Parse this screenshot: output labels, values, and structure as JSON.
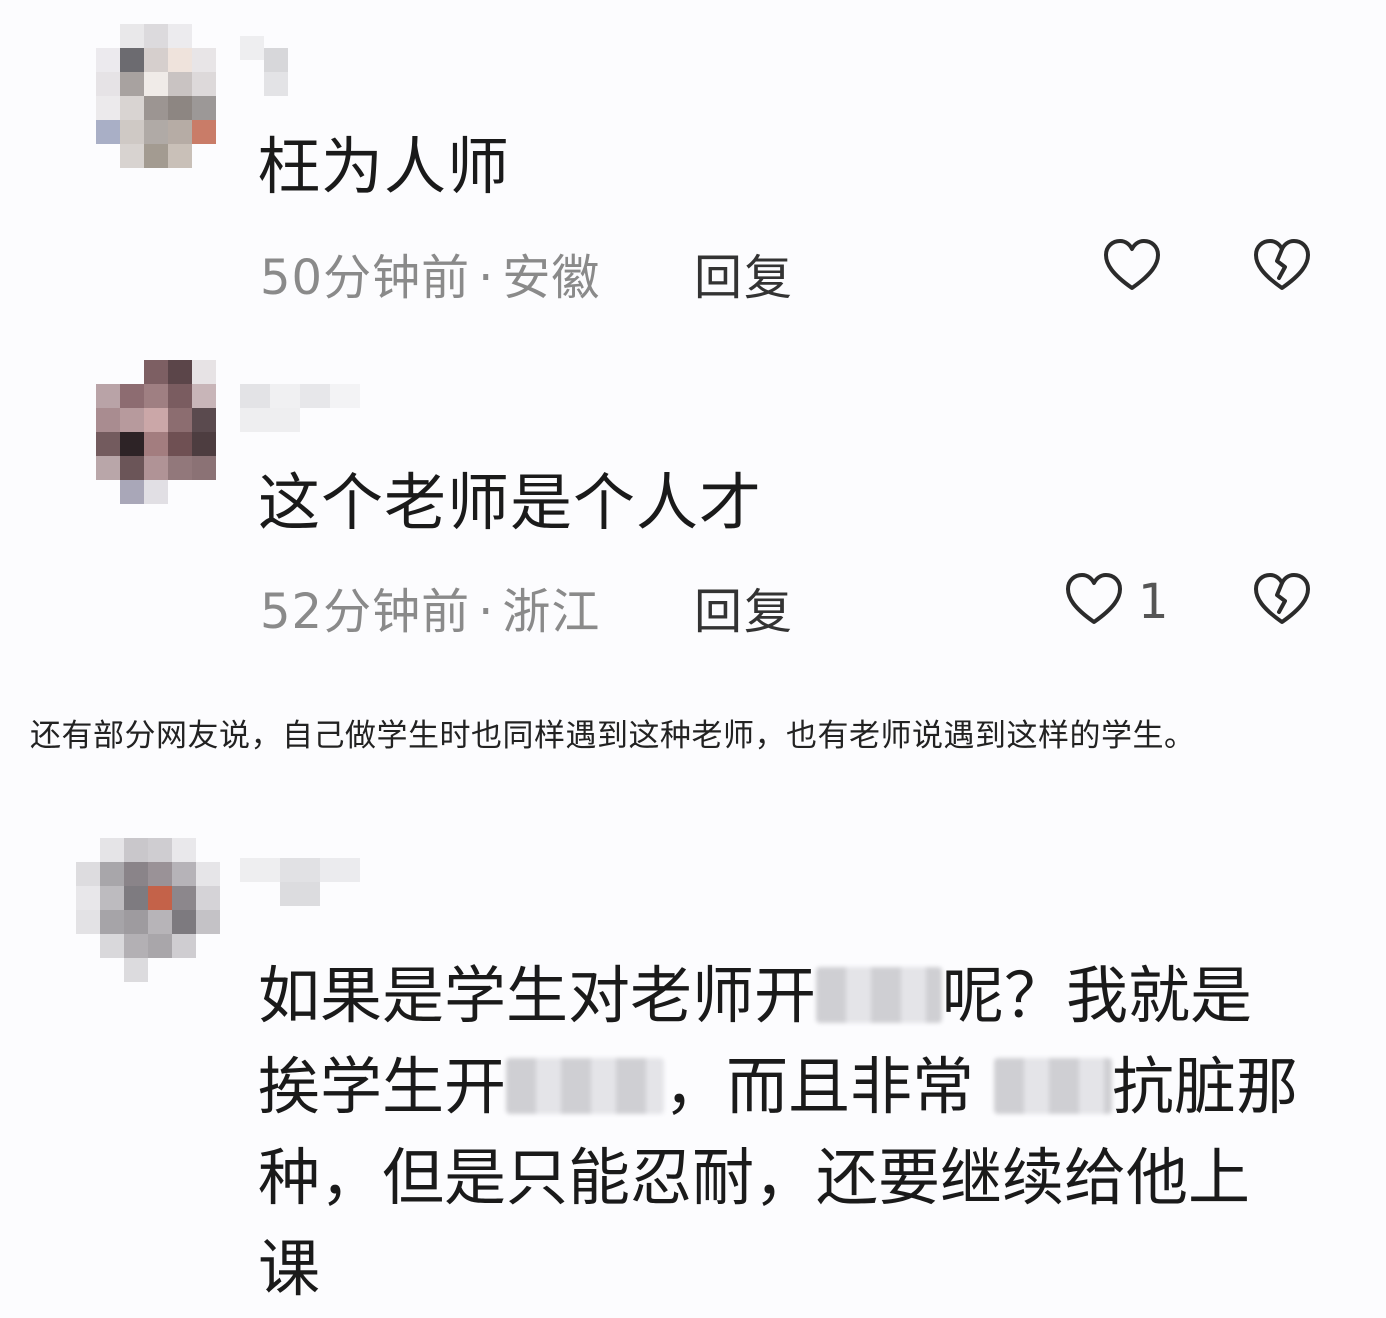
{
  "comments": [
    {
      "text": "枉为人师",
      "time": "50分钟前",
      "location": "安徽",
      "reply_label": "回复",
      "like_count": ""
    },
    {
      "text": "这个老师是个人才",
      "time": "52分钟前",
      "location": "浙江",
      "reply_label": "回复",
      "like_count": "1"
    },
    {
      "lines": [
        {
          "a": "如果是学生对老师开",
          "b": "呢？我就是"
        },
        {
          "a": "挨学生开",
          "b": "，而且非常",
          "c": "抗脏那"
        },
        {
          "a": "种，但是只能忍耐，还要继续给他上"
        },
        {
          "a": "课"
        }
      ]
    }
  ],
  "separator": "·",
  "caption": "还有部分网友说，自己做学生时也同样遇到这种老师，也有老师说遇到这样的学生。",
  "icons": {
    "like": "heart-outline-icon",
    "dislike": "broken-heart-icon"
  },
  "colors": {
    "text": "#1a1a1a",
    "meta": "#8a8a8a",
    "icon": "#2b2b2b"
  }
}
